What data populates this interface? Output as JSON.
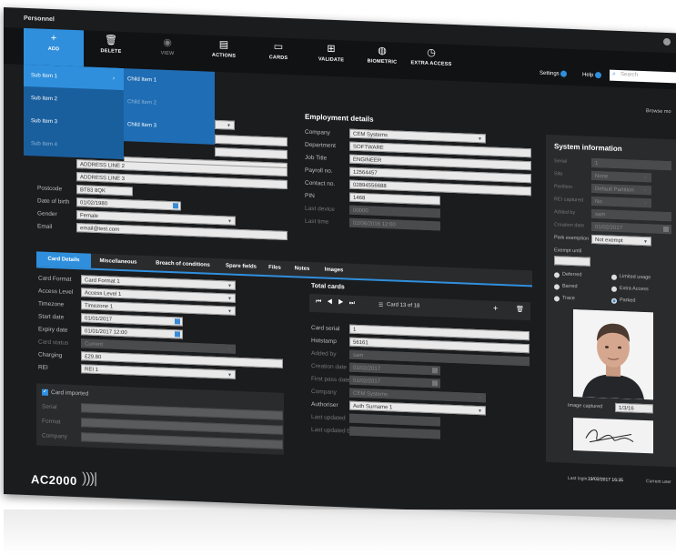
{
  "window": {
    "title": "Personnel"
  },
  "toolbar": {
    "add": "ADD",
    "delete": "DELETE",
    "view": "VIEW",
    "actions": "ACTIONS",
    "cards": "CARDS",
    "validate": "VALIDATE",
    "biometric": "BIOMETRIC",
    "extra_access": "EXTRA ACCESS",
    "settings": "Settings",
    "help": "Help",
    "search_placeholder": "Search",
    "browse": "Browse mo"
  },
  "menu": {
    "sub_items": [
      "Sub Item 1",
      "Sub Item 2",
      "Sub Item 3",
      "Sub Item 4"
    ],
    "child_items": [
      "Child Item 1",
      "Child Item 2",
      "Child Item 3"
    ]
  },
  "personal": {
    "address2": "ADDRESS LINE 2",
    "address3": "ADDRESS LINE 3",
    "postcode_label": "Postcode",
    "postcode": "BT83 8QK",
    "dob_label": "Date of birth",
    "dob": "01/02/1980",
    "gender_label": "Gender",
    "gender": "Female",
    "email_label": "Email",
    "email": "email@test.com"
  },
  "employment": {
    "title": "Employment details",
    "company_label": "Company",
    "company": "CEM Systems",
    "department_label": "Department",
    "department": "SOFTWARE",
    "jobtitle_label": "Job Title",
    "jobtitle": "ENGINEER",
    "payroll_label": "Payroll no.",
    "payroll": "12564457",
    "contact_label": "Contact no.",
    "contact": "02894556688",
    "pin_label": "PIN",
    "pin": "1468",
    "lastdevice_label": "Last device",
    "lastdevice": "00000",
    "lasttime_label": "Last time",
    "lasttime": "02/06/2016 12:00"
  },
  "system": {
    "title": "System information",
    "serial_label": "Serial",
    "serial": "1",
    "site_label": "Site",
    "site": "None",
    "partition_label": "Partition",
    "partition": "Default Partition",
    "rei_label": "REI captured",
    "rei": "No",
    "addedby_label": "Added by",
    "addedby": "sam",
    "creation_label": "Creation date",
    "creation": "01/02/2017",
    "park_label": "Park exemption",
    "park": "Not exempt",
    "exempt_label": "Exempt until",
    "radios": [
      "Deferred",
      "Limited usage",
      "Barred",
      "Extra Access",
      "Trace",
      "Parked"
    ],
    "image_captured_label": "Image captured",
    "image_captured": "1/3/16",
    "last_login_label": "Last login",
    "last_login": "19/02/2017 16:35",
    "current_user_label": "Current user"
  },
  "tabs": [
    "Card Details",
    "Miscellaneous",
    "Breach of conditions",
    "Spare fields",
    "Files",
    "Notes",
    "Images"
  ],
  "card": {
    "format_label": "Card Format",
    "format": "Card Format 1",
    "access_label": "Access Level",
    "access": "Access Level 1",
    "timezone_label": "Timezone",
    "timezone": "Timezone 1",
    "start_label": "Start date",
    "start": "01/01/2017",
    "expiry_label": "Expiry date",
    "expiry": "01/01/2017 12:00",
    "status_label": "Card status",
    "status": "Current",
    "charging_label": "Charging",
    "charging": "£29.80",
    "rei_label": "REI",
    "rei": "REI 1",
    "imported_label": "Card imported",
    "serial_label": "Serial",
    "format2_label": "Format",
    "company_label": "Company"
  },
  "totals": {
    "title": "Total cards",
    "nav_text": "Card 13 of 18",
    "cardserial_label": "Card serial",
    "cardserial": "1",
    "hotstamp_label": "Hotstamp",
    "hotstamp": "56161",
    "addedby_label": "Added by",
    "addedby": "sam",
    "creation_label": "Creation date",
    "creation": "01/02/2017",
    "firstpass_label": "First pass date",
    "firstpass": "01/02/2017",
    "company_label": "Company",
    "company": "CEM Systems",
    "authoriser_label": "Authoriser",
    "authoriser": "Auth Surname 1",
    "lastupdated_label": "Last updated",
    "lastupdatedby_label": "Last updated by"
  },
  "brand": {
    "logo": "AC2000"
  },
  "colors": {
    "accent": "#2f8fdc",
    "panel": "#2a2b2d",
    "background": "#1b1c1e"
  }
}
